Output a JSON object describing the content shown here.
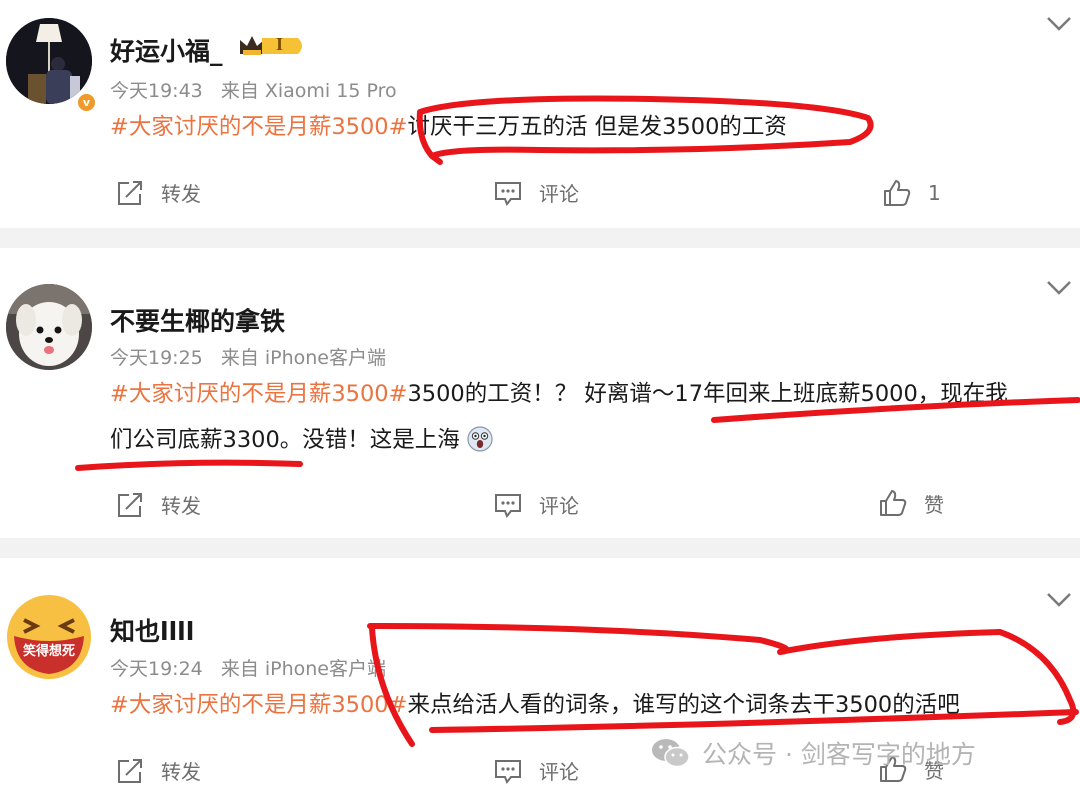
{
  "posts": [
    {
      "username": "好运小福_",
      "level_badge": "I",
      "time": "今天19:43",
      "source": "来自 Xiaomi 15 Pro",
      "tag": "#大家讨厌的不是月薪3500#",
      "text_lines": [
        "讨厌干三万五的活 但是发3500的工资"
      ],
      "repost_label": "转发",
      "comment_label": "评论",
      "like_label": "1"
    },
    {
      "username": "不要生椰的拿铁",
      "time": "今天19:25",
      "source": "来自 iPhone客户端",
      "tag": "#大家讨厌的不是月薪3500#",
      "text_lines": [
        "3500的工资！？ 好离谱～17年回来上班底薪5000，现在我",
        "们公司底薪3300。没错！这是上海"
      ],
      "repost_label": "转发",
      "comment_label": "评论",
      "like_label": "赞"
    },
    {
      "username": "知也llll",
      "avatar_text": "笑得想死",
      "time": "今天19:24",
      "source": "来自 iPhone客户端",
      "tag": "#大家讨厌的不是月薪3500#",
      "text_lines": [
        "来点给活人看的词条，谁写的这个词条去干3500的活吧"
      ],
      "repost_label": "转发",
      "comment_label": "评论",
      "like_label": "赞"
    }
  ],
  "watermark": "公众号 · 剑客写字的地方",
  "colors": {
    "hashtag": "#eb7340",
    "annotation": "#e8161a",
    "separator": "#f2f2f2"
  },
  "icons": [
    "repost-icon",
    "comment-icon",
    "like-icon",
    "chevron-down-icon",
    "wechat-icon"
  ]
}
